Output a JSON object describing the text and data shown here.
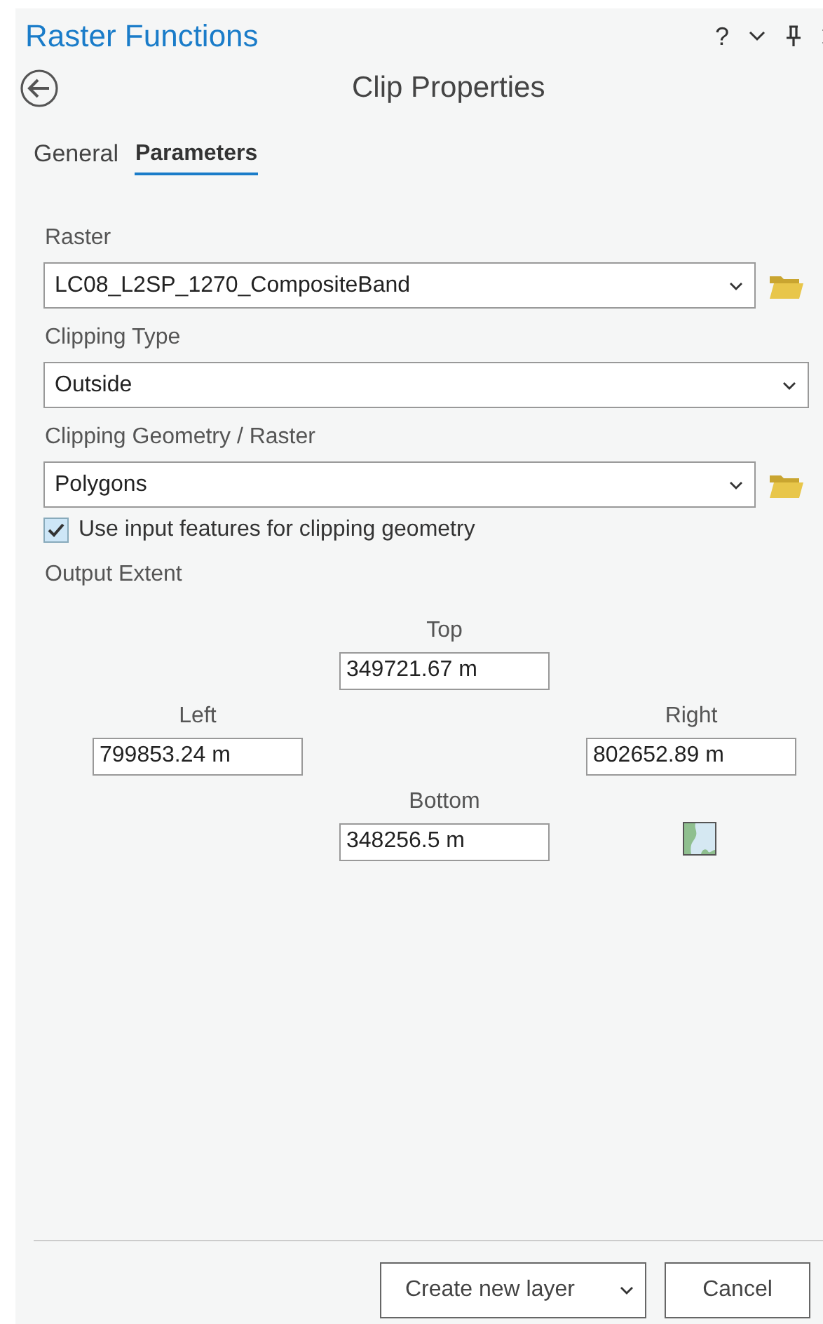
{
  "pane": {
    "title": "Raster Functions",
    "help": "?"
  },
  "header": {
    "title": "Clip Properties"
  },
  "tabs": [
    {
      "label": "General",
      "selected": false
    },
    {
      "label": "Parameters",
      "selected": true
    }
  ],
  "fields": [
    {
      "kind": "dropdown",
      "label": "Raster",
      "value": "LC08_L2SP_1270_CompositeBand",
      "browse": true
    },
    {
      "kind": "dropdown",
      "label": "Clipping Type",
      "value": "Outside",
      "browse": false
    },
    {
      "kind": "dropdown",
      "label": "Clipping Geometry / Raster",
      "value": "Polygons",
      "browse": true
    },
    {
      "kind": "checkbox",
      "label": "Use input features for clipping geometry",
      "checked": true
    }
  ],
  "extent": {
    "label": "Output Extent",
    "top": {
      "label": "Top",
      "value": "349721.67 m"
    },
    "left": {
      "label": "Left",
      "value": "799853.24 m"
    },
    "right": {
      "label": "Right",
      "value": "802652.89 m"
    },
    "bottom": {
      "label": "Bottom",
      "value": "348256.5 m"
    }
  },
  "footer": {
    "primary": "Create new layer",
    "cancel": "Cancel"
  }
}
